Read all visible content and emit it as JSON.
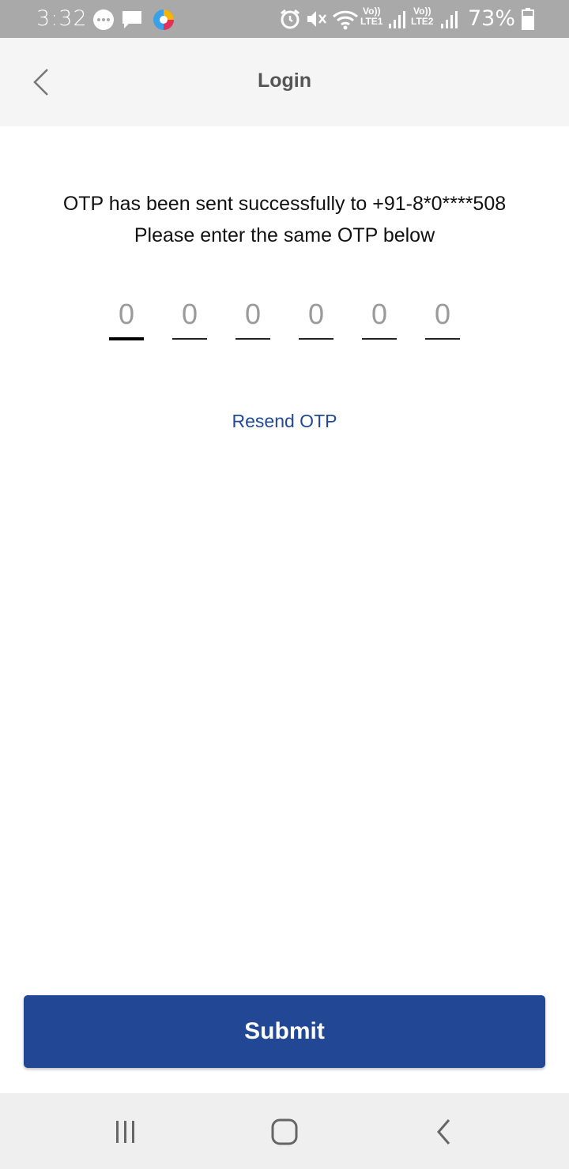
{
  "status_bar": {
    "time": "3:32",
    "battery_percent": "73%",
    "sim1_label_top": "Vo))",
    "sim1_label_bottom": "LTE1",
    "sim2_label_top": "Vo))",
    "sim2_label_bottom": "LTE2",
    "icons": [
      "message-bubble-icon",
      "chat-icon",
      "browser-app-icon",
      "alarm-icon",
      "mute-icon",
      "wifi-icon",
      "signal-icon",
      "battery-icon"
    ]
  },
  "header": {
    "title": "Login",
    "back_icon": "chevron-left-icon"
  },
  "message": {
    "line1": "OTP has been sent successfully to +91-8*0****508",
    "line2": "Please enter the same OTP below"
  },
  "otp": {
    "digits": [
      "0",
      "0",
      "0",
      "0",
      "0",
      "0"
    ],
    "active_index": 0
  },
  "resend_label": "Resend OTP",
  "submit_label": "Submit",
  "colors": {
    "primary": "#224895",
    "link": "#234a96",
    "status_bar": "#a9a9a9",
    "header_bg": "#f5f5f5"
  },
  "nav_bar": {
    "icons": [
      "recent-apps-icon",
      "home-icon",
      "back-icon"
    ]
  }
}
